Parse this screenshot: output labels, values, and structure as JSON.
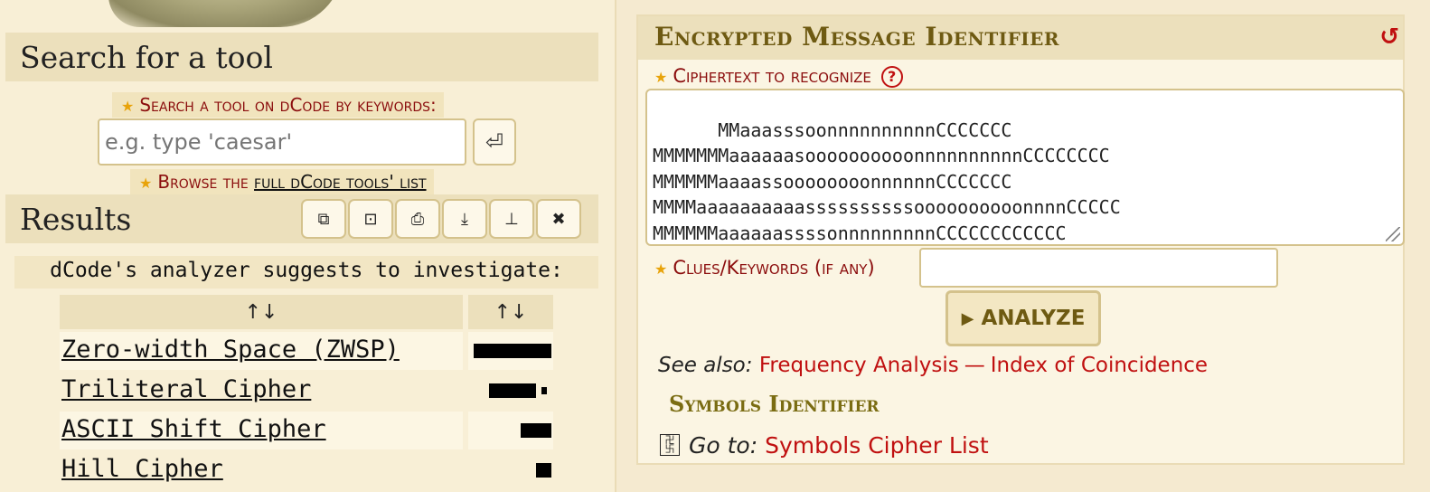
{
  "search": {
    "heading": "Search for a tool",
    "keywords_label": "Search a tool on dCode by keywords:",
    "placeholder": "e.g. type 'caesar'",
    "enter_icon": "⏎",
    "browse_prefix": "Browse the ",
    "browse_link": "full dCode tools' list"
  },
  "results": {
    "heading": "Results",
    "toolbar": [
      {
        "icon": "copy-icon",
        "glyph": "⧉"
      },
      {
        "icon": "screenshot-icon",
        "glyph": "⊡"
      },
      {
        "icon": "print-icon",
        "glyph": "⎙"
      },
      {
        "icon": "download-icon",
        "glyph": "⤓"
      },
      {
        "icon": "pin-icon",
        "glyph": "⊥"
      },
      {
        "icon": "close-icon",
        "glyph": "✖"
      }
    ],
    "analyzer_note": "dCode's analyzer suggests to investigate:",
    "columns": [
      "↑↓",
      "↑↓"
    ],
    "rows": [
      {
        "name": "Zero-width Space (ZWSP)",
        "score": 6
      },
      {
        "name": "Triliteral Cipher",
        "score": 4.5
      },
      {
        "name": "ASCII Shift Cipher",
        "score": 2
      },
      {
        "name": "Hill Cipher",
        "score": 1
      }
    ]
  },
  "identifier": {
    "title": "Encrypted Message Identifier",
    "reset_icon": "↺",
    "ciphertext_label": "Ciphertext to recognize",
    "help_glyph": "?",
    "ciphertext": "MMaaasssoonnnnnnnnnnCCCCCCC\nMMMMMMMaaaaaasoooooooooonnnnnnnnnnCCCCCCCC\nMMMMMMaaaassoooooooonnnnnnCCCCCCC\nMMMMaaaaaaaaaassssssssssoooooooooonnnnCCCCC\nMMMMMMaaaaaassssonnnnnnnnnCCCCCCCCCCCC\nMMMMMMaaassoooooonCCCCCCC",
    "clues_label": "Clues/Keywords (if any)",
    "clues_value": "",
    "analyze_label": "ANALYZE",
    "analyze_icon": "▶"
  },
  "see_also": {
    "prefix": "See also: ",
    "links": [
      "Frequency Analysis",
      "Index of Coincidence"
    ],
    "separator": "—"
  },
  "symbols": {
    "heading": "Symbols Identifier",
    "goto_prefix": "Go to: ",
    "goto_link": "Symbols Cipher List",
    "icon_glyph": "卍\n卐"
  },
  "colors": {
    "accent_red": "#c01010",
    "label_red": "#8b0d0d",
    "title_olive": "#6e5a12",
    "star": "#e8a30a"
  }
}
